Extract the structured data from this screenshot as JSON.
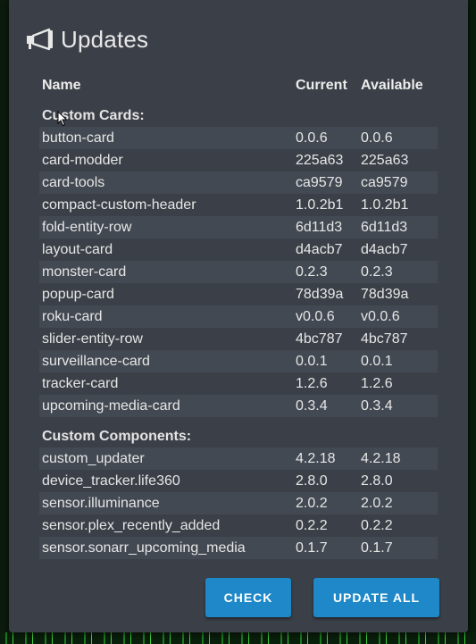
{
  "header": {
    "title": "Updates",
    "icon": "megaphone-icon"
  },
  "columns": {
    "name": "Name",
    "current": "Current",
    "available": "Available"
  },
  "sections": [
    {
      "title": "Custom Cards:",
      "rows": [
        {
          "name": "button-card",
          "current": "0.0.6",
          "available": "0.0.6"
        },
        {
          "name": "card-modder",
          "current": "225a63",
          "available": "225a63"
        },
        {
          "name": "card-tools",
          "current": "ca9579",
          "available": "ca9579"
        },
        {
          "name": "compact-custom-header",
          "current": "1.0.2b1",
          "available": "1.0.2b1"
        },
        {
          "name": "fold-entity-row",
          "current": "6d11d3",
          "available": "6d11d3"
        },
        {
          "name": "layout-card",
          "current": "d4acb7",
          "available": "d4acb7"
        },
        {
          "name": "monster-card",
          "current": "0.2.3",
          "available": "0.2.3"
        },
        {
          "name": "popup-card",
          "current": "78d39a",
          "available": "78d39a"
        },
        {
          "name": "roku-card",
          "current": "v0.0.6",
          "available": "v0.0.6"
        },
        {
          "name": "slider-entity-row",
          "current": "4bc787",
          "available": "4bc787"
        },
        {
          "name": "surveillance-card",
          "current": "0.0.1",
          "available": "0.0.1"
        },
        {
          "name": "tracker-card",
          "current": "1.2.6",
          "available": "1.2.6"
        },
        {
          "name": "upcoming-media-card",
          "current": "0.3.4",
          "available": "0.3.4"
        }
      ]
    },
    {
      "title": "Custom Components:",
      "rows": [
        {
          "name": "custom_updater",
          "current": "4.2.18",
          "available": "4.2.18"
        },
        {
          "name": "device_tracker.life360",
          "current": "2.8.0",
          "available": "2.8.0"
        },
        {
          "name": "sensor.illuminance",
          "current": "2.0.2",
          "available": "2.0.2"
        },
        {
          "name": "sensor.plex_recently_added",
          "current": "0.2.2",
          "available": "0.2.2"
        },
        {
          "name": "sensor.sonarr_upcoming_media",
          "current": "0.1.7",
          "available": "0.1.7"
        }
      ]
    }
  ],
  "actions": {
    "check": "CHECK",
    "update_all": "UPDATE ALL"
  },
  "colors": {
    "card_bg": "#3b4048",
    "row_alt": "#434952",
    "button": "#1e88c8",
    "text": "#e6e6e6"
  }
}
